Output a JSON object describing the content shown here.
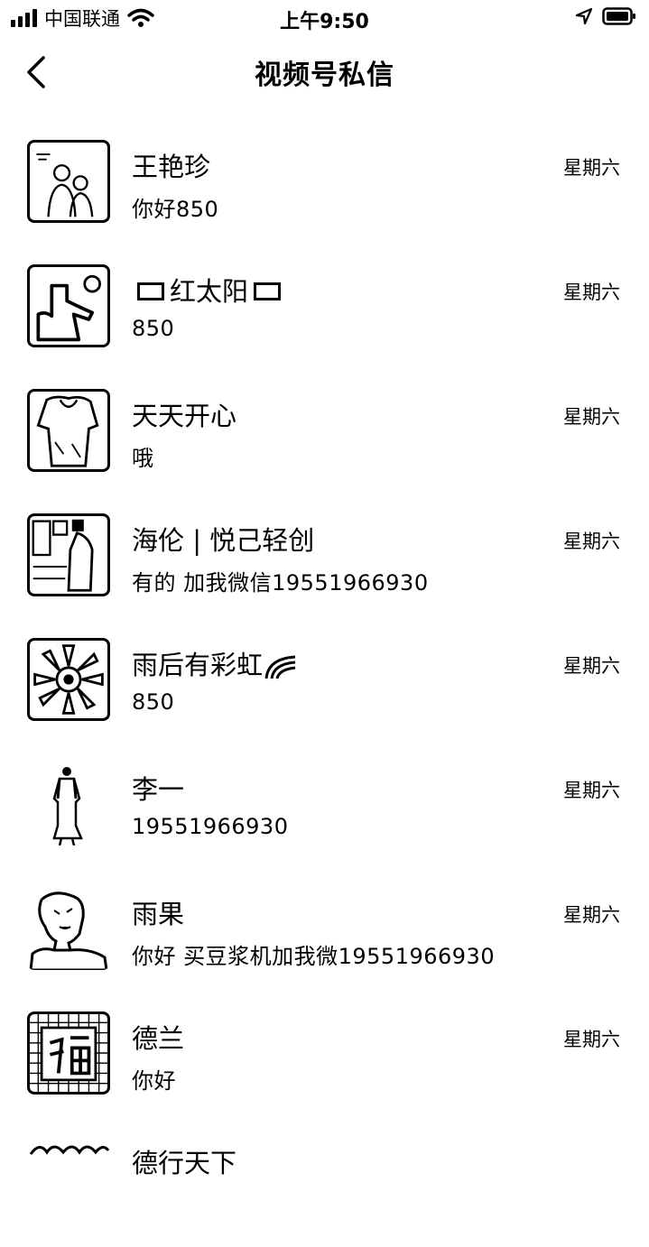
{
  "status_bar": {
    "carrier": "中国联通",
    "time": "上午9:50"
  },
  "nav": {
    "title": "视频号私信"
  },
  "conversations": [
    {
      "name": "王艳珍",
      "message": "你好850",
      "time": "星期六",
      "avatar": "couple-photo-avatar"
    },
    {
      "name": "红太阳",
      "message": "850",
      "time": "星期六",
      "avatar": "silhouette-avatar"
    },
    {
      "name": "天天开心",
      "message": "哦",
      "time": "星期六",
      "avatar": "person-photo-avatar"
    },
    {
      "name": "海伦 | 悦己轻创",
      "message": "有的 加我微信19551966930",
      "time": "星期六",
      "avatar": "room-photo-avatar"
    },
    {
      "name": "雨后有彩虹",
      "message": "850",
      "time": "星期六",
      "avatar": "flower-avatar"
    },
    {
      "name": "李一",
      "message": "19551966930",
      "time": "星期六",
      "avatar": "standing-woman-avatar"
    },
    {
      "name": "雨果",
      "message": "你好 买豆浆机加我微19551966930",
      "time": "星期六",
      "avatar": "sketch-portrait-avatar"
    },
    {
      "name": "德兰",
      "message": "你好",
      "time": "星期六",
      "avatar": "fu-character-avatar"
    },
    {
      "name": "德行天下",
      "message": "",
      "time": "",
      "avatar": "partial-avatar"
    }
  ]
}
